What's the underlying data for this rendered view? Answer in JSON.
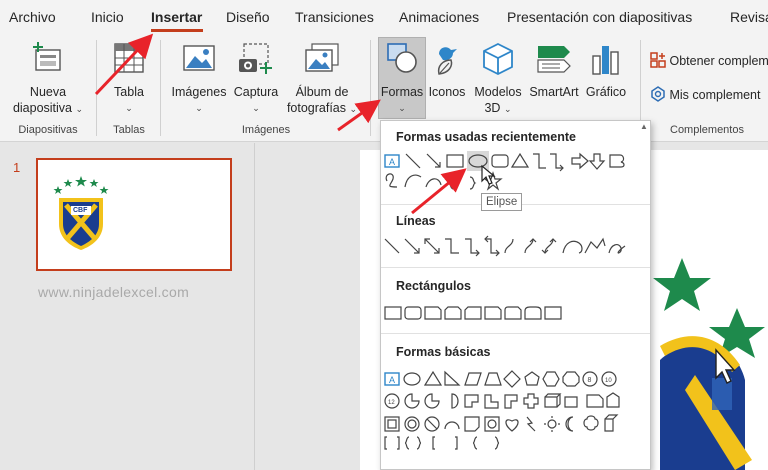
{
  "tabs": [
    "Archivo",
    "Inicio",
    "Insertar",
    "Diseño",
    "Transiciones",
    "Animaciones",
    "Presentación con diapositivas",
    "Revisa"
  ],
  "active_tab": "Insertar",
  "ribbon": {
    "nueva_l1": "Nueva",
    "nueva_l2": "diapositiva",
    "tabla": "Tabla",
    "imagenes": "Imágenes",
    "captura": "Captura",
    "album_l1": "Álbum de",
    "album_l2": "fotografías",
    "formas": "Formas",
    "iconos": "Iconos",
    "modelos_l1": "Modelos",
    "modelos_l2": "3D",
    "smartart": "SmartArt",
    "grafico": "Gráfico",
    "obtener": "Obtener complem",
    "mis": "Mis complement",
    "groups": {
      "diapositivas": "Diapositivas",
      "tablas": "Tablas",
      "imagenes": "Imágenes",
      "complementos": "Complementos"
    }
  },
  "slides_panel": {
    "slide_number": "1",
    "thumb_logo_text": "CBF",
    "watermark": "www.ninjadelexcel.com"
  },
  "shapes_menu": {
    "recent": "Formas usadas recientemente",
    "lines": "Líneas",
    "rectangles": "Rectángulos",
    "basic": "Formas básicas",
    "tooltip": "Elipse"
  },
  "colors": {
    "accent": "#c43e1c",
    "annotation_arrow": "#e8232a",
    "star_green": "#1e8a4c",
    "shield_blue": "#1a3d8f",
    "shield_yellow": "#f2c21b"
  }
}
